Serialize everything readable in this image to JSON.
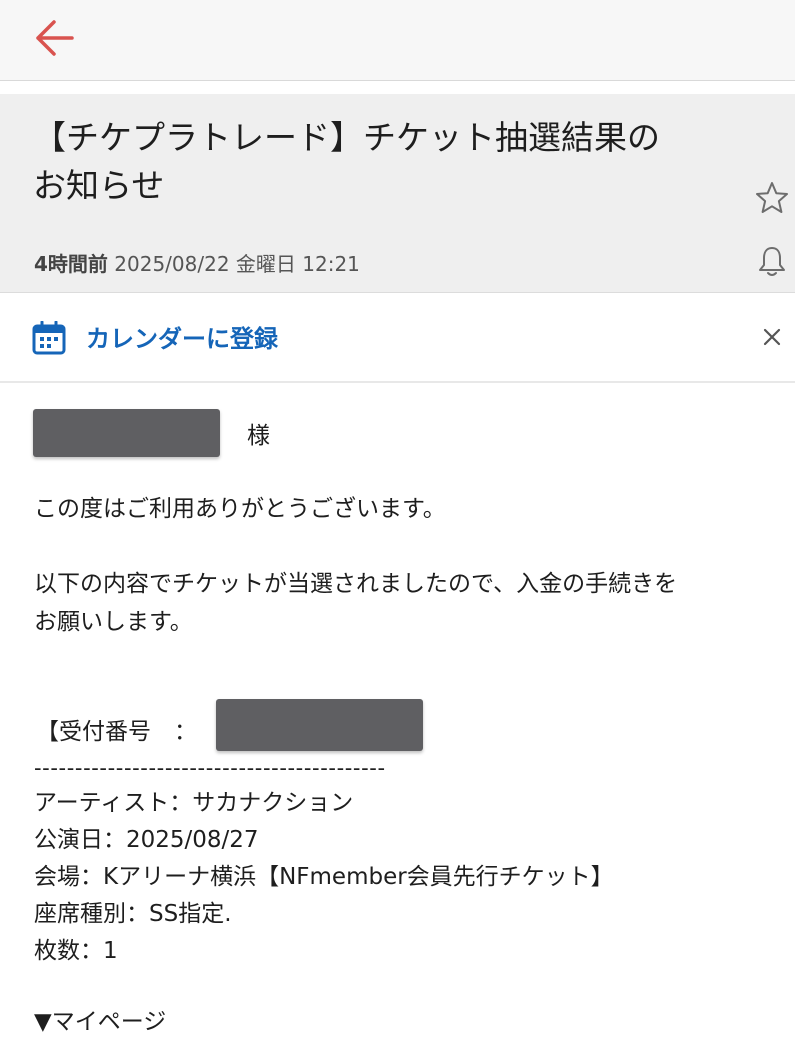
{
  "header": {
    "back_icon": "arrow-left-icon",
    "accent_color": "#d9534f"
  },
  "email": {
    "subject_line1": "【チケプラトレード】チケット抽選結果の",
    "subject_line2": "お知らせ",
    "time_relative": "4時間前",
    "date": "2025/08/22 金曜日 12:21",
    "star_icon": "star-icon",
    "bell_icon": "bell-icon"
  },
  "calendar_bar": {
    "label": "カレンダーに登録",
    "icon": "calendar-icon",
    "close_icon": "close-icon",
    "link_color": "#1565b8"
  },
  "body": {
    "honorific": "様",
    "greeting": "この度はご利用ありがとうございます。",
    "notice_line1": "以下の内容でチケットが当選されましたので、入金の手続きを",
    "notice_line2": "お願いします。",
    "receipt_label": "【受付番号　：",
    "separator": "-------------------------------------------",
    "artist": "アーティスト：サカナクション",
    "show_date": "公演日：2025/08/27",
    "venue": "会場：Kアリーナ横浜【NFmember会員先行チケット】",
    "seat_type": "座席種別：SS指定.",
    "count": "枚数：1",
    "mypage": "▼マイページ"
  }
}
